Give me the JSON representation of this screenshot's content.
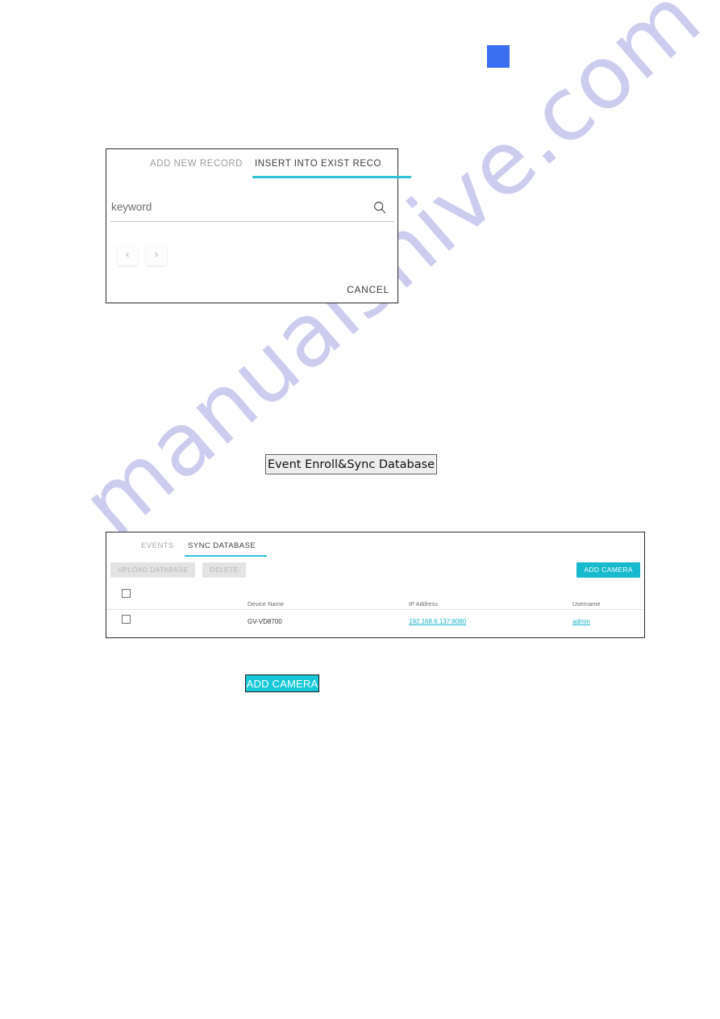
{
  "page": {
    "watermark_text": "manualshive.com",
    "marker_color": "#3b6ef0",
    "accent_color": "#2ec3d8",
    "teal_button_color": "#16b9cd"
  },
  "record_dialog": {
    "tabs": [
      {
        "label": "ADD NEW RECORD",
        "active": false
      },
      {
        "label": "INSERT INTO EXIST RECO",
        "active": true
      }
    ],
    "search": {
      "placeholder": "keyword",
      "value": "",
      "icon": "search-icon"
    },
    "pager": {
      "prev_glyph": "‹",
      "next_glyph": "›"
    },
    "cancel_label": "CANCEL"
  },
  "callouts": {
    "event_enroll": "Event Enroll&Sync Database",
    "add_camera": "ADD CAMERA"
  },
  "sync_panel": {
    "tabs": [
      {
        "label": "EVENTS",
        "active": false
      },
      {
        "label": "SYNC DATABASE",
        "active": true
      }
    ],
    "actions": {
      "upload_label": "UPLOAD DATABASE",
      "delete_label": "DELETE",
      "add_camera_label": "ADD CAMERA"
    },
    "table": {
      "columns": [
        "Device Name",
        "IP Address",
        "Username"
      ],
      "rows": [
        {
          "selected": false,
          "device_name": "GV-VD8700",
          "ip_address": "192.168.6.137:8080",
          "username": "admin"
        }
      ]
    }
  }
}
